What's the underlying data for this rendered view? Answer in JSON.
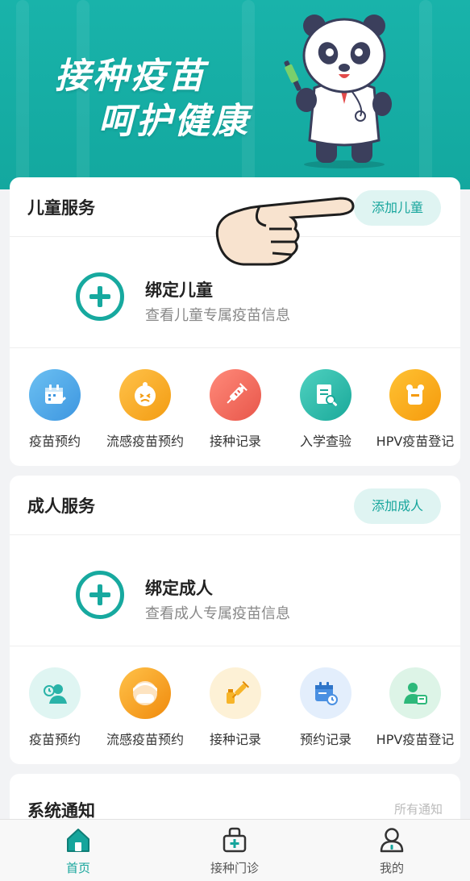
{
  "banner": {
    "slogan_line1": "接种疫苗",
    "slogan_line2": "呵护健康"
  },
  "child_service": {
    "title": "儿童服务",
    "add_button": "添加儿童",
    "bind_title": "绑定儿童",
    "bind_subtitle": "查看儿童专属疫苗信息",
    "items": [
      {
        "label": "疫苗预约",
        "icon": "calendar-syringe-icon",
        "color": "#4aa8e8"
      },
      {
        "label": "流感疫苗预约",
        "icon": "sick-child-icon",
        "color": "#f5a623"
      },
      {
        "label": "接种记录",
        "icon": "syringe-icon",
        "color": "#f06a5f"
      },
      {
        "label": "入学查验",
        "icon": "document-search-icon",
        "color": "#1fb5a3"
      },
      {
        "label": "HPV疫苗登记",
        "icon": "hpv-register-icon",
        "color": "#f7a21b"
      }
    ]
  },
  "adult_service": {
    "title": "成人服务",
    "add_button": "添加成人",
    "bind_title": "绑定成人",
    "bind_subtitle": "查看成人专属疫苗信息",
    "items": [
      {
        "label": "疫苗预约",
        "icon": "person-appointment-icon",
        "color": "#29b3a8"
      },
      {
        "label": "流感疫苗预约",
        "icon": "masked-person-icon",
        "color": "#f5a623"
      },
      {
        "label": "接种记录",
        "icon": "vaccine-bottle-icon",
        "color": "#f7b529"
      },
      {
        "label": "预约记录",
        "icon": "calendar-clock-icon",
        "color": "#4a90e2"
      },
      {
        "label": "HPV疫苗登记",
        "icon": "doctor-card-icon",
        "color": "#2db87a"
      }
    ]
  },
  "notice": {
    "title": "系统通知",
    "all_link": "所有通知"
  },
  "tabbar": {
    "items": [
      {
        "label": "首页",
        "icon": "home-icon",
        "active": true
      },
      {
        "label": "接种门诊",
        "icon": "clinic-icon",
        "active": false
      },
      {
        "label": "我的",
        "icon": "user-icon",
        "active": false
      }
    ]
  },
  "colors": {
    "primary": "#16a59c",
    "banner": "#19b3aa",
    "pill_bg": "#dff4f2"
  }
}
